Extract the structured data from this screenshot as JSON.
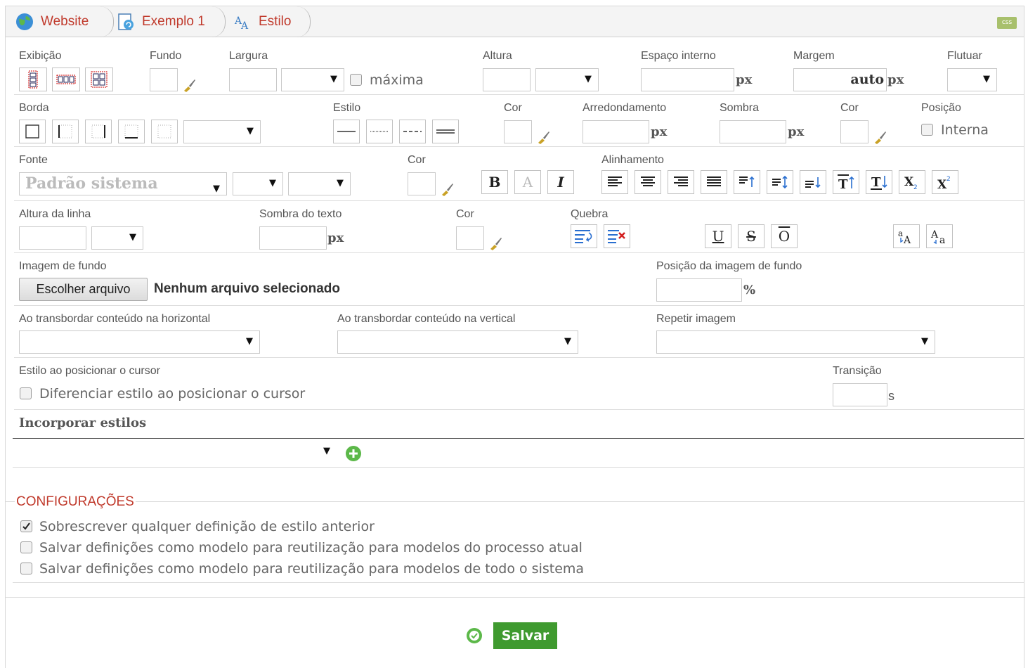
{
  "breadcrumbs": [
    {
      "label": "Website"
    },
    {
      "label": "Exemplo 1"
    },
    {
      "label": "Estilo"
    }
  ],
  "css_badge": "css",
  "row1": {
    "exibicao": "Exibição",
    "fundo": "Fundo",
    "largura": "Largura",
    "maxima": "máxima",
    "altura": "Altura",
    "espaco_interno": "Espaço interno",
    "espaco_unit": "px",
    "margem": "Margem",
    "margem_value": "auto",
    "margem_unit": "px",
    "flutuar": "Flutuar"
  },
  "row2": {
    "borda": "Borda",
    "estilo": "Estilo",
    "cor": "Cor",
    "arredondamento": "Arredondamento",
    "arred_unit": "px",
    "sombra": "Sombra",
    "sombra_unit": "px",
    "cor2": "Cor",
    "posicao": "Posição",
    "interna": "Interna"
  },
  "row3": {
    "fonte": "Fonte",
    "fonte_placeholder": "Padrão sistema",
    "cor": "Cor",
    "alinhamento": "Alinhamento",
    "bold": "B",
    "font_a": "A",
    "italic": "I"
  },
  "row4": {
    "altura_linha": "Altura da linha",
    "sombra_texto": "Sombra do texto",
    "sombra_unit": "px",
    "cor": "Cor",
    "quebra": "Quebra",
    "underline": "U",
    "strike": "S",
    "overline": "O"
  },
  "row5": {
    "imagem_fundo": "Imagem de fundo",
    "escolher": "Escolher arquivo",
    "nenhum": "Nenhum arquivo selecionado",
    "posicao_imagem": "Posição da imagem de fundo",
    "percent": "%"
  },
  "row6": {
    "transbordar_h": "Ao transbordar conteúdo na horizontal",
    "transbordar_v": "Ao transbordar conteúdo na vertical",
    "repetir": "Repetir imagem"
  },
  "row7": {
    "estilo_cursor": "Estilo ao posicionar o cursor",
    "diferenciar": "Diferenciar estilo ao posicionar o cursor",
    "transicao": "Transição",
    "trans_unit": "s"
  },
  "incorporar": "Incorporar estilos",
  "configuracoes": {
    "title": "CONFIGURAÇÕES",
    "options": [
      {
        "label": "Sobrescrever qualquer definição de estilo anterior",
        "checked": true
      },
      {
        "label": "Salvar definições como modelo para reutilização para modelos do processo atual",
        "checked": false
      },
      {
        "label": "Salvar definições como modelo para reutilização para modelos de todo o sistema",
        "checked": false
      }
    ]
  },
  "save_label": "Salvar",
  "colors": {
    "accent": "#c0392b",
    "save": "#3f9a2f"
  }
}
